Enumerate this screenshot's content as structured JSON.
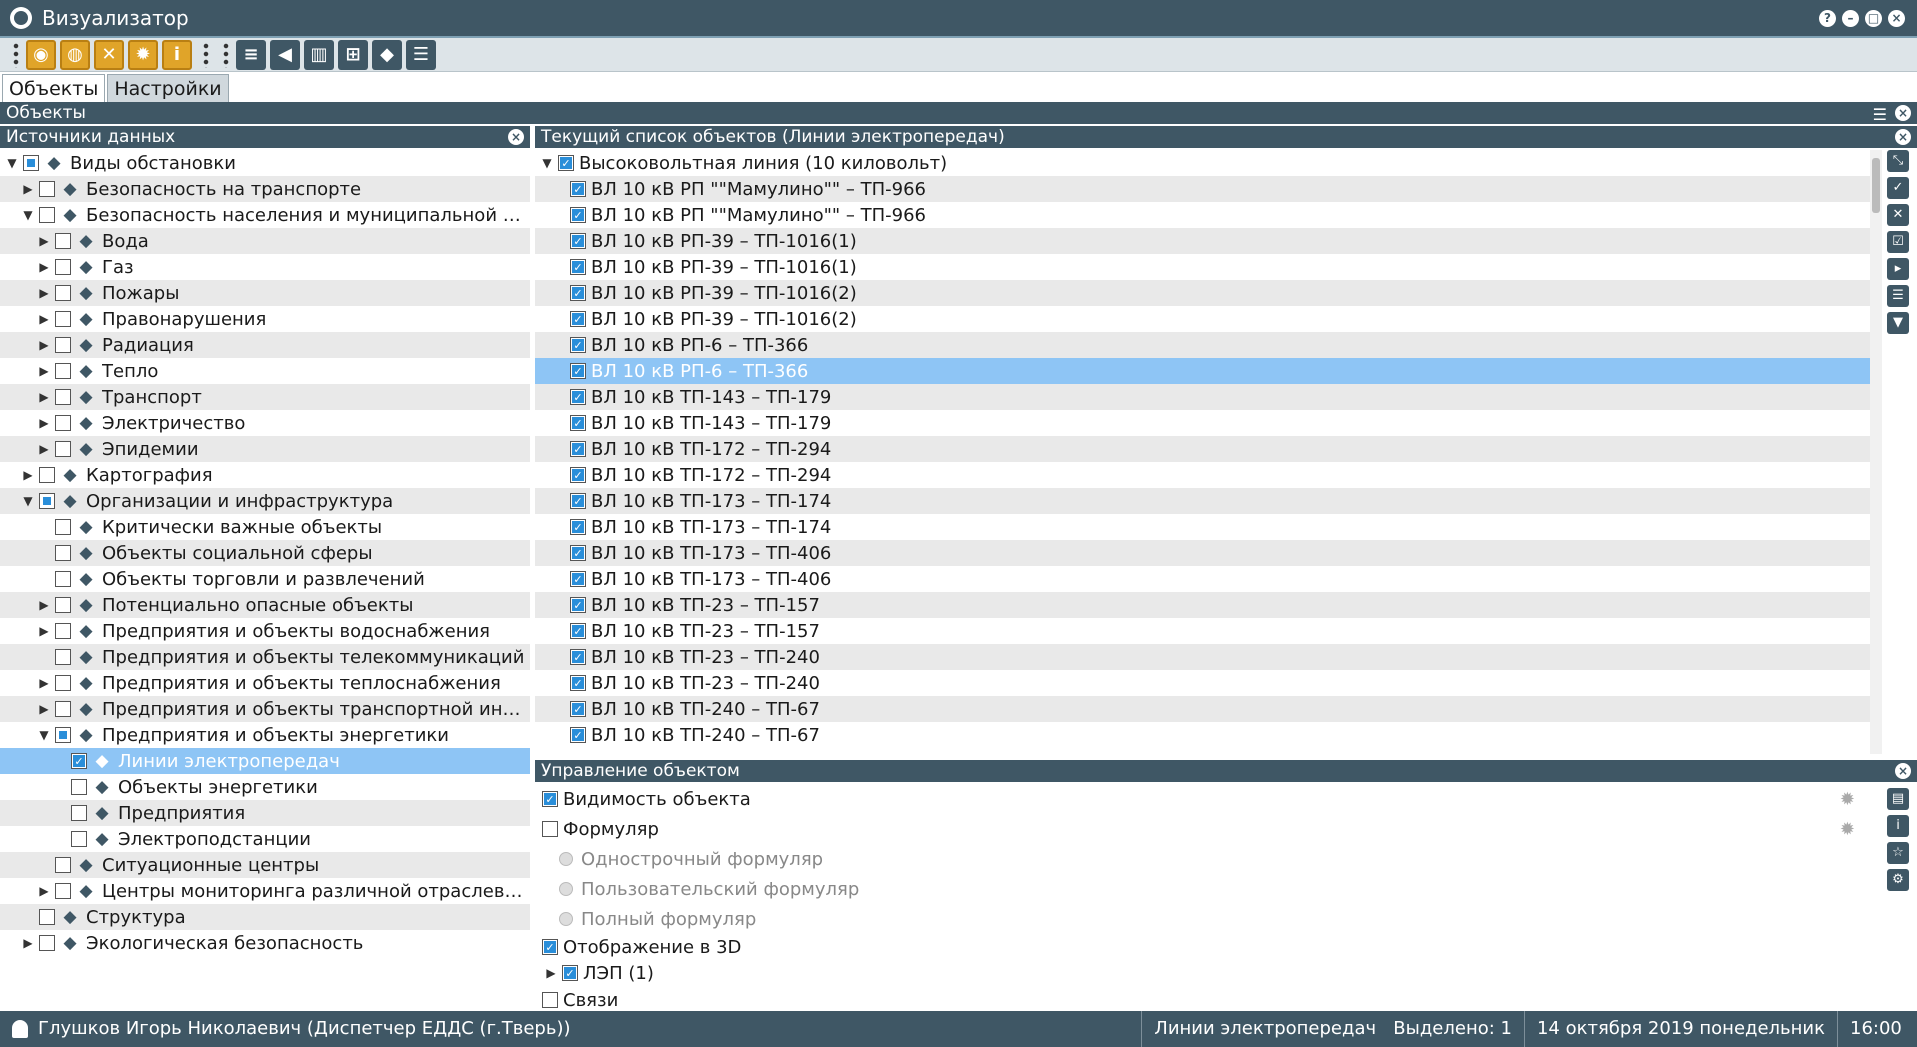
{
  "window": {
    "title": "Визуализатор"
  },
  "tabs": [
    {
      "label": "Объекты"
    },
    {
      "label": "Настройки"
    }
  ],
  "objects_panel": {
    "title": "Объекты"
  },
  "sources_panel": {
    "title": "Источники данных"
  },
  "list_panel": {
    "title": "Текущий список объектов (Линии электропередач)"
  },
  "control_panel": {
    "title": "Управление объектом"
  },
  "tree": [
    {
      "label": "Виды обстановки",
      "level": 0,
      "arrow": "down",
      "check": "part",
      "icon": "layers-icon"
    },
    {
      "label": "Безопасность на транспорте",
      "level": 1,
      "arrow": "right",
      "check": "off",
      "icon": "transport-safety-icon"
    },
    {
      "label": "Безопасность населения и муниципальной и...",
      "level": 1,
      "arrow": "down",
      "check": "off",
      "icon": "building-icon"
    },
    {
      "label": "Вода",
      "level": 2,
      "arrow": "right",
      "check": "off",
      "icon": "water-icon"
    },
    {
      "label": "Газ",
      "level": 2,
      "arrow": "right",
      "check": "off",
      "icon": "gas-icon"
    },
    {
      "label": "Пожары",
      "level": 2,
      "arrow": "right",
      "check": "off",
      "icon": "fire-icon"
    },
    {
      "label": "Правонарушения",
      "level": 2,
      "arrow": "right",
      "check": "off",
      "icon": "police-icon"
    },
    {
      "label": "Радиация",
      "level": 2,
      "arrow": "right",
      "check": "off",
      "icon": "radiation-icon"
    },
    {
      "label": "Тепло",
      "level": 2,
      "arrow": "right",
      "check": "off",
      "icon": "heat-icon"
    },
    {
      "label": "Транспорт",
      "level": 2,
      "arrow": "right",
      "check": "off",
      "icon": "transport-icon"
    },
    {
      "label": "Электричество",
      "level": 2,
      "arrow": "right",
      "check": "off",
      "icon": "electricity-icon"
    },
    {
      "label": "Эпидемии",
      "level": 2,
      "arrow": "right",
      "check": "off",
      "icon": "epidemic-icon"
    },
    {
      "label": "Картография",
      "level": 1,
      "arrow": "right",
      "check": "off",
      "icon": "map-icon"
    },
    {
      "label": "Организации и инфраструктура",
      "level": 1,
      "arrow": "down",
      "check": "part",
      "icon": "factory-icon"
    },
    {
      "label": "Критически важные объекты",
      "level": 2,
      "arrow": "",
      "check": "off",
      "icon": "critical-icon"
    },
    {
      "label": "Объекты социальной сферы",
      "level": 2,
      "arrow": "",
      "check": "off",
      "icon": "social-icon"
    },
    {
      "label": "Объекты торговли и развлечений",
      "level": 2,
      "arrow": "",
      "check": "off",
      "icon": "cart-icon"
    },
    {
      "label": "Потенциально опасные объекты",
      "level": 2,
      "arrow": "right",
      "check": "off",
      "icon": "danger-icon"
    },
    {
      "label": "Предприятия и объекты водоснабжения",
      "level": 2,
      "arrow": "right",
      "check": "off",
      "icon": "water-supply-icon"
    },
    {
      "label": "Предприятия и объекты телекоммуникаций",
      "level": 2,
      "arrow": "",
      "check": "off",
      "icon": "antenna-icon"
    },
    {
      "label": "Предприятия и объекты теплоснабжения",
      "level": 2,
      "arrow": "right",
      "check": "off",
      "icon": "heat-supply-icon"
    },
    {
      "label": "Предприятия и объекты транспортной инф...",
      "level": 2,
      "arrow": "right",
      "check": "off",
      "icon": "bus-icon"
    },
    {
      "label": "Предприятия и объекты энергетики",
      "level": 2,
      "arrow": "down",
      "check": "part",
      "icon": "lightning-icon"
    },
    {
      "label": "Линии электропередач",
      "level": 3,
      "arrow": "",
      "check": "on",
      "icon": "power-line-icon",
      "selected": true
    },
    {
      "label": "Объекты энергетики",
      "level": 3,
      "arrow": "",
      "check": "off",
      "icon": "energy-icon"
    },
    {
      "label": "Предприятия",
      "level": 3,
      "arrow": "",
      "check": "off",
      "icon": "enterprise-icon"
    },
    {
      "label": "Электроподстанции",
      "level": 3,
      "arrow": "",
      "check": "off",
      "icon": "substation-icon"
    },
    {
      "label": "Ситуационные центры",
      "level": 2,
      "arrow": "",
      "check": "off",
      "icon": "situation-center-icon"
    },
    {
      "label": "Центры мониторинга различной отраслево...",
      "level": 2,
      "arrow": "right",
      "check": "off",
      "icon": "monitoring-icon"
    },
    {
      "label": "Структура",
      "level": 1,
      "arrow": "",
      "check": "off",
      "icon": "structure-icon"
    },
    {
      "label": "Экологическая безопасность",
      "level": 1,
      "arrow": "right",
      "check": "off",
      "icon": "ecology-icon"
    }
  ],
  "list": {
    "group": {
      "label": "Высоковольтная линия (10 киловольт)",
      "check": "on"
    },
    "items": [
      {
        "label": "ВЛ 10 кВ РП \"\"Мамулино\"\" – ТП-966"
      },
      {
        "label": "ВЛ 10 кВ РП \"\"Мамулино\"\" – ТП-966"
      },
      {
        "label": "ВЛ 10 кВ РП-39 – ТП-1016(1)"
      },
      {
        "label": "ВЛ 10 кВ РП-39 – ТП-1016(1)"
      },
      {
        "label": "ВЛ 10 кВ РП-39 – ТП-1016(2)"
      },
      {
        "label": "ВЛ 10 кВ РП-39 – ТП-1016(2)"
      },
      {
        "label": "ВЛ 10 кВ РП-6 – ТП-366"
      },
      {
        "label": "ВЛ 10 кВ РП-6 – ТП-366",
        "selected": true
      },
      {
        "label": "ВЛ 10 кВ ТП-143 – ТП-179"
      },
      {
        "label": "ВЛ 10 кВ ТП-143 – ТП-179"
      },
      {
        "label": "ВЛ 10 кВ ТП-172 – ТП-294"
      },
      {
        "label": "ВЛ 10 кВ ТП-172 – ТП-294"
      },
      {
        "label": "ВЛ 10 кВ ТП-173 – ТП-174"
      },
      {
        "label": "ВЛ 10 кВ ТП-173 – ТП-174"
      },
      {
        "label": "ВЛ 10 кВ ТП-173 – ТП-406"
      },
      {
        "label": "ВЛ 10 кВ ТП-173 – ТП-406"
      },
      {
        "label": "ВЛ 10 кВ ТП-23 – ТП-157"
      },
      {
        "label": "ВЛ 10 кВ ТП-23 – ТП-157"
      },
      {
        "label": "ВЛ 10 кВ ТП-23 – ТП-240"
      },
      {
        "label": "ВЛ 10 кВ ТП-23 – ТП-240"
      },
      {
        "label": "ВЛ 10 кВ ТП-240 – ТП-67"
      },
      {
        "label": "ВЛ 10 кВ ТП-240 – ТП-67"
      }
    ]
  },
  "control": {
    "visibility": "Видимость объекта",
    "formular": "Формуляр",
    "single_line": "Однострочный формуляр",
    "custom": "Пользовательский формуляр",
    "full": "Полный формуляр",
    "display_3d": "Отображение в 3D",
    "lep": "ЛЭП (1)",
    "links": "Связи"
  },
  "status": {
    "user": "Глушков Игорь Николаевич (Диспетчер ЕДДС (г.Тверь))",
    "layer": "Линии электропередач",
    "selected": "Выделено: 1",
    "date": "14 октября 2019 понедельник",
    "time": "16:00"
  },
  "colors": {
    "header": "#3f5765",
    "selection": "#8ec5f5",
    "accent": "#e0a429"
  }
}
